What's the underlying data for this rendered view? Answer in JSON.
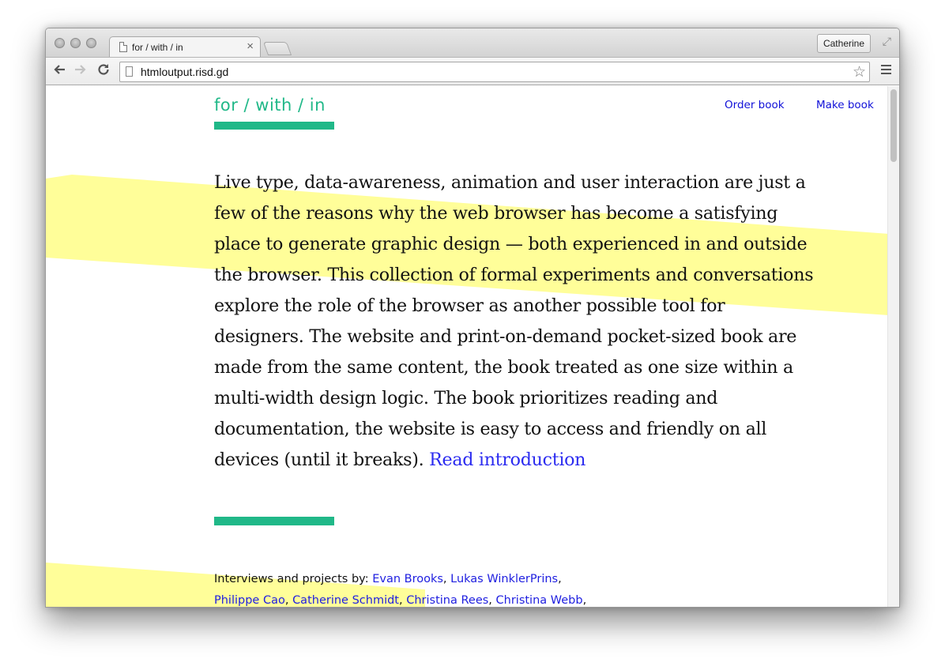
{
  "window": {
    "tab_title": "for / with / in",
    "tab_close": "×",
    "profile_name": "Catherine",
    "url": "htmloutput.risd.gd"
  },
  "icons": {
    "back": "arrow-left-icon",
    "forward": "arrow-right-icon",
    "reload": "reload-icon",
    "star": "bookmark-star-icon",
    "menu": "hamburger-menu-icon",
    "page": "page-icon",
    "fullscreen": "fullscreen-icon"
  },
  "colors": {
    "accent_green": "#20b888",
    "highlight_yellow": "#fffe99",
    "link_blue": "#2b2bf0"
  },
  "site": {
    "logo": "for / with / in",
    "nav": {
      "order_book": "Order book",
      "make_book": "Make book"
    },
    "intro_text": "Live type, data-awareness, animation and user interaction are just a few of the reasons why the web browser has become a satisfying place to generate graphic design — both experienced in and outside the browser. This collection of formal experiments and conversations explore the role of the browser as another possible tool for designers. The website and print-on-demand pocket-sized book are made from the same content, the book treated as one size within a multi-width design logic. The book prioritizes reading and documentation, the website is easy to access and friendly on all devices (until it breaks).",
    "intro_link": "Read introduction",
    "credits_label": "Interviews and projects by:",
    "contributors": [
      "Evan Brooks",
      "Lukas WinklerPrins",
      "Philippe Cao",
      "Catherine Schmidt",
      "Christina Rees",
      "Christina Webb"
    ]
  }
}
